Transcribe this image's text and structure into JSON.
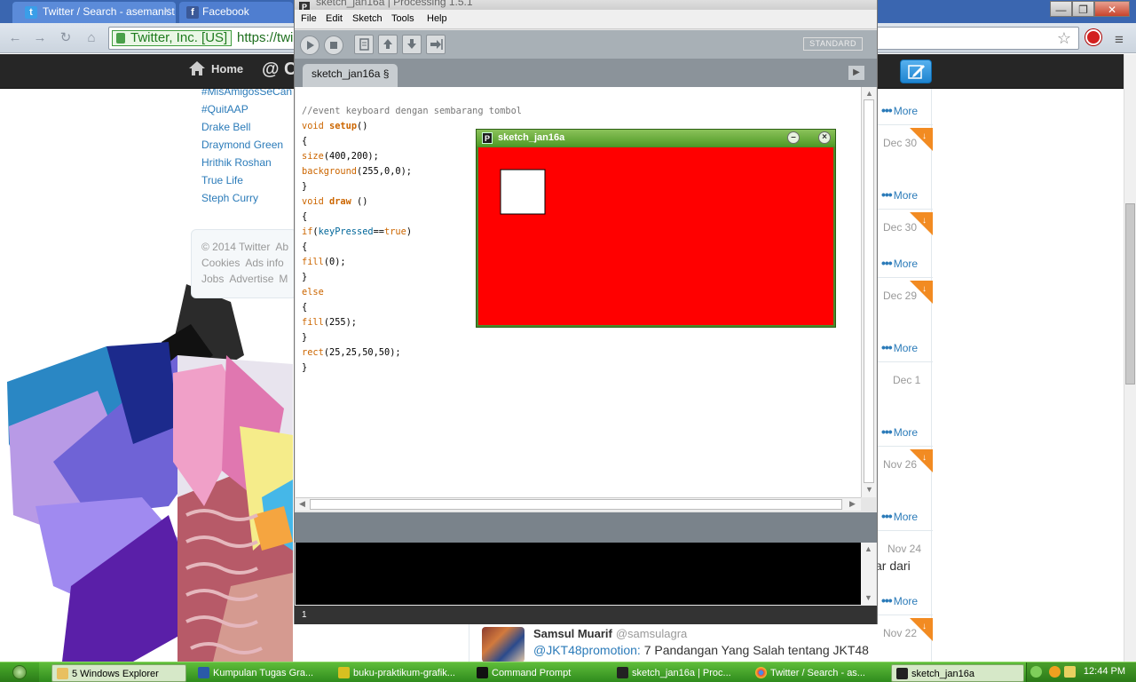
{
  "browser": {
    "tabs": [
      {
        "label": "Twitter / Search - asemanist",
        "close": "×"
      },
      {
        "label": "Facebook"
      }
    ],
    "ev_label": "Twitter, Inc. [US]",
    "url": "https://twi",
    "window_buttons": {
      "minimize": "—",
      "maximize": "❐",
      "close": "✕"
    }
  },
  "twitter": {
    "nav_home": "Home",
    "nav_at": "@ C",
    "trends": [
      "#MisAmigosSeCan",
      "#QuitAAP",
      "Drake Bell",
      "Draymond Green",
      "Hrithik Roshan",
      "True Life",
      "Steph Curry"
    ],
    "footer": {
      "line1": [
        "© 2014 Twitter",
        "Ab"
      ],
      "line2": [
        "Cookies",
        "Ads info"
      ],
      "line3": [
        "Jobs",
        "Advertise",
        "M"
      ]
    },
    "dates": [
      "Dec 30",
      "Dec 30",
      "Dec 29",
      "Dec 1",
      "Nov 26",
      "Nov 24",
      "Nov 22"
    ],
    "more_label": "More",
    "more_dots": "•••",
    "partial_text": "ar dari",
    "tweet": {
      "author": "Samsul Muarif",
      "handle": "@samsulagra",
      "mention": "@JKT48promotion:",
      "text": " 7 Pandangan Yang Salah tentang JKT48"
    }
  },
  "processing": {
    "title": "sketch_jan16a | Processing 1.5.1",
    "menu": [
      "File",
      "Edit",
      "Sketch",
      "Tools",
      "Help"
    ],
    "mode": "STANDARD",
    "tab": "sketch_jan16a §",
    "line_number": "1",
    "code": [
      "//event keyboard dengan sembarang tombol",
      "void setup()",
      "{",
      "size(400,200);",
      "background(255,0,0);",
      "}",
      "void draw ()",
      "{",
      "if(keyPressed==true)",
      "{",
      "fill(0);",
      "}",
      "else",
      "{",
      "fill(255);",
      "}",
      "rect(25,25,50,50);",
      "}"
    ]
  },
  "sketch": {
    "title": "sketch_jan16a",
    "minimize": "–",
    "close": "×",
    "background_color": "#ff0000",
    "rect_fill": "#ffffff"
  },
  "taskbar": {
    "items": [
      "5 Windows Explorer",
      "Kumpulan Tugas Gra...",
      "buku-praktikum-grafik...",
      "Command Prompt",
      "sketch_jan16a | Proc...",
      "Twitter / Search - as...",
      "sketch_jan16a"
    ],
    "clock": "12:44 PM"
  }
}
